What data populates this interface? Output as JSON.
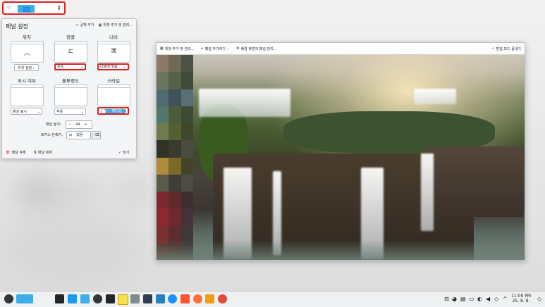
{
  "top_panel": {
    "menu_icon": "kickoff-dots-icon",
    "drag_icon": "drag-handle-icon"
  },
  "config": {
    "title": "패널 설정",
    "add_spacer": "공백 추가",
    "add_widgets": "위젯 추가 및 관리...",
    "position": {
      "label": "위치",
      "button": "위치 설정..."
    },
    "alignment": {
      "label": "정렬",
      "value": "왼쪽"
    },
    "width": {
      "label": "너비",
      "value": "내용에 맞춤"
    },
    "visibility": {
      "label": "표시 여부",
      "value": "항상 표시"
    },
    "opacity": {
      "label": "불투명도",
      "value": "적응"
    },
    "style": {
      "label": "스타일",
      "value": "떠다님"
    },
    "panel_height": {
      "label": "패널 높이:",
      "value": "44",
      "minus": "−",
      "plus": "+"
    },
    "focus_shortcut": {
      "label": "포커스 단축키:",
      "value": "없음"
    },
    "delete_panel": "패널 삭제",
    "copy_panel": "패널 복제",
    "close": "닫기"
  },
  "window": {
    "toolbar": {
      "add_widgets": "위젯 추가 및 관리...",
      "add_panel": "패널 추가하기",
      "wallpaper": "배경 화면과 패널 관리...",
      "done": "편집 모드 끝내기"
    }
  },
  "taskbar": {
    "time": "11:09 PM",
    "date": "25. 8. 8."
  }
}
